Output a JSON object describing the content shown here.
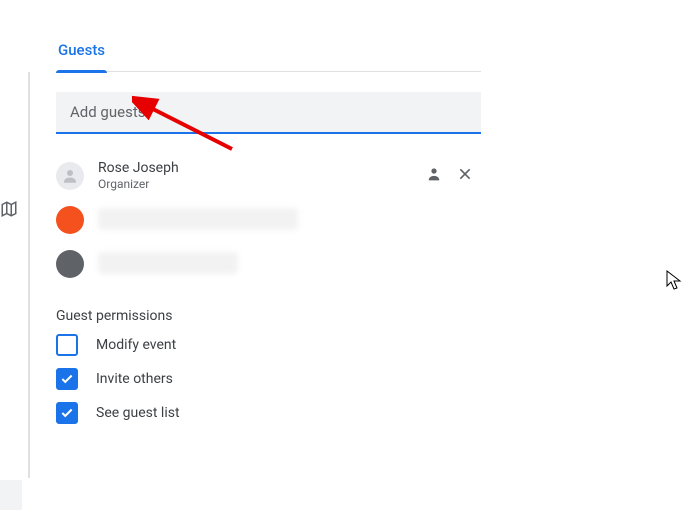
{
  "tabs": {
    "guests": "Guests"
  },
  "input": {
    "placeholder": "Add guests"
  },
  "organizer": {
    "name": "Rose Joseph",
    "role": "Organizer"
  },
  "permissions": {
    "title": "Guest permissions",
    "items": [
      {
        "label": "Modify event",
        "checked": false
      },
      {
        "label": "Invite others",
        "checked": true
      },
      {
        "label": "See guest list",
        "checked": true
      }
    ]
  }
}
